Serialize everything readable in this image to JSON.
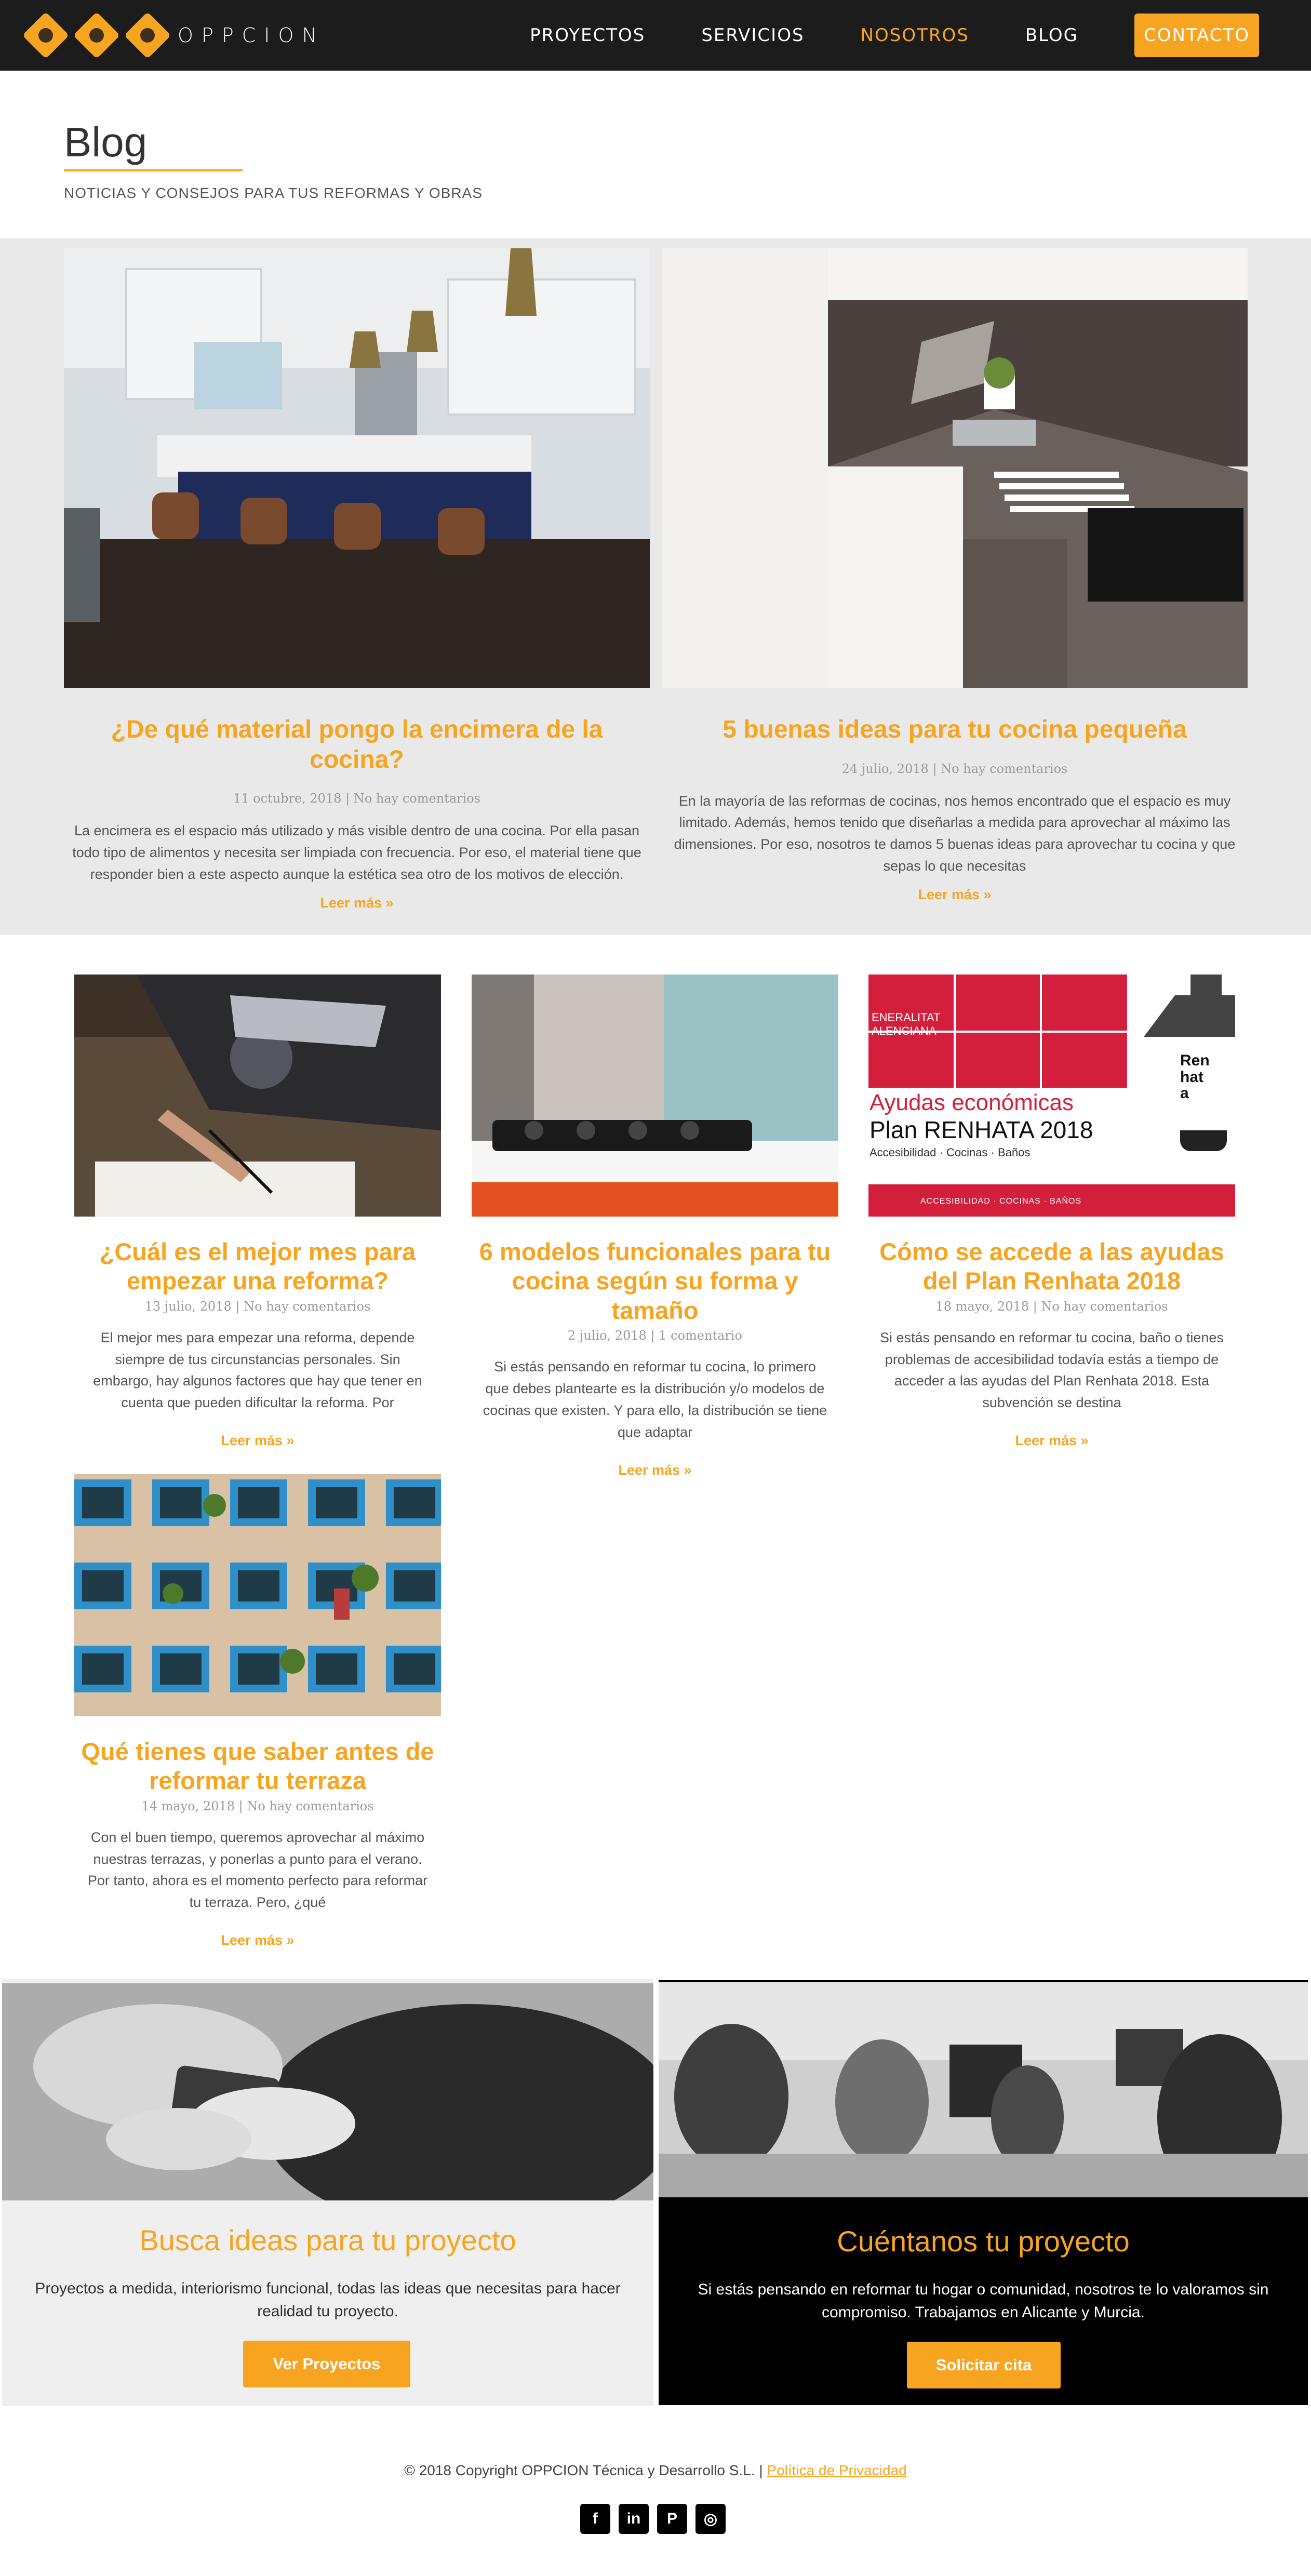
{
  "header": {
    "logo_text": "OPPCION",
    "nav": [
      "PROYECTOS",
      "SERVICIOS",
      "NOSOTROS",
      "BLOG"
    ],
    "contact": "CONTACTO",
    "accent_color": "#f7a521"
  },
  "page": {
    "title": "Blog",
    "subtitle": "NOTICIAS Y CONSEJOS PARA TUS REFORMAS Y OBRAS"
  },
  "featured": [
    {
      "title": "¿De qué material pongo la encimera de la cocina?",
      "meta": "11 octubre, 2018 | No hay comentarios",
      "excerpt": "La encimera es el espacio más utilizado y más visible dentro de una cocina. Por ella pasan todo tipo de alimentos y necesita ser limpiada con frecuencia. Por eso, el material tiene que responder bien a este aspecto aunque la estética sea otro de los motivos de elección.",
      "more": "Leer más »"
    },
    {
      "title": "5 buenas ideas para tu cocina pequeña",
      "meta": "24 julio, 2018 | No hay comentarios",
      "excerpt": "En la mayoría de las reformas de cocinas, nos hemos encontrado que el espacio es muy limitado. Además, hemos tenido que diseñarlas a medida para aprovechar al máximo las dimensiones. Por eso, nosotros te damos 5 buenas ideas para aprovechar tu cocina y que sepas lo que necesitas",
      "more": "Leer más »"
    }
  ],
  "posts": [
    {
      "title": "¿Cuál es el mejor mes para empezar una reforma?",
      "meta": "13 julio, 2018 | No hay comentarios",
      "excerpt": "El mejor mes para empezar una reforma, depende siempre de tus circunstancias personales. Sin embargo, hay algunos factores que hay que tener en cuenta que pueden dificultar la reforma. Por",
      "more": "Leer más »"
    },
    {
      "title": "6 modelos funcionales para tu cocina según su forma y tamaño",
      "meta": "2 julio, 2018 | 1 comentario",
      "excerpt": "Si estás pensando en reformar tu cocina, lo primero que debes plantearte es la distribución y/o modelos de cocinas que existen. Y para ello, la distribución se tiene que adaptar",
      "more": "Leer más »"
    },
    {
      "title": "Cómo se accede a las ayudas del Plan Renhata 2018",
      "meta": "18 mayo, 2018 | No hay comentarios",
      "excerpt": "Si estás pensando en reformar tu cocina, baño o tienes problemas de accesibilidad todavía estás a tiempo de acceder a las ayudas del Plan Renhata 2018. Esta subvención se destina",
      "more": "Leer más »",
      "image_text": {
        "gva": "ENERALITAT ALENCIANA",
        "line1": "Ayudas económicas",
        "line2": "Plan RENHATA 2018",
        "line3": "Accesibilidad · Cocinas · Baños",
        "footer": "ACCESIBILIDAD  ·  COCINAS  ·  BAÑOS",
        "vertical": "Renhata"
      }
    },
    {
      "title": "Qué tienes que saber antes de reformar tu terraza",
      "meta": "14 mayo, 2018 | No hay comentarios",
      "excerpt": "Con el buen tiempo, queremos aprovechar al máximo nuestras terrazas, y ponerlas a punto para el verano. Por tanto, ahora es el momento perfecto para reformar tu terraza. Pero, ¿qué",
      "more": "Leer más »"
    }
  ],
  "cta": {
    "left": {
      "title": "Busca ideas para tu proyecto",
      "text": "Proyectos a medida, interiorismo funcional, todas las ideas que necesitas para hacer realidad tu proyecto.",
      "button": "Ver Proyectos"
    },
    "right": {
      "title": "Cuéntanos tu proyecto",
      "text": "Si estás pensando en reformar tu hogar o comunidad, nosotros te lo valoramos sin compromiso. Trabajamos en Alicante y Murcia.",
      "button": "Solicitar cita"
    }
  },
  "footer": {
    "copyright": "© 2018 Copyright OPPCION Técnica y Desarrollo S.L. |",
    "privacy": "Política de Privacidad",
    "socials": [
      {
        "icon": "facebook-icon",
        "glyph": "f"
      },
      {
        "icon": "linkedin-icon",
        "glyph": "in"
      },
      {
        "icon": "pinterest-icon",
        "glyph": "P"
      },
      {
        "icon": "instagram-icon",
        "glyph": "◎"
      }
    ]
  }
}
